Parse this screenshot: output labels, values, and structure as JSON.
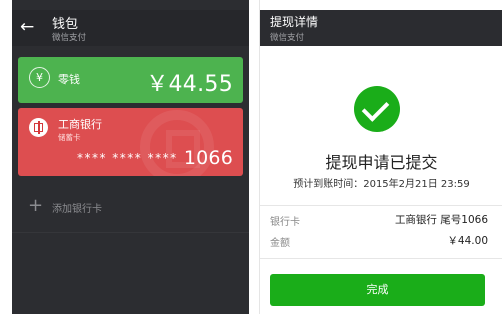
{
  "wallet": {
    "title": "钱包",
    "subtitle": "微信支付",
    "change": {
      "icon": "yen-circle-icon",
      "label": "零钱",
      "amount": "￥44.55"
    },
    "bank_card": {
      "icon": "icbc-logo-icon",
      "bank_name": "工商银行",
      "card_type": "储蓄卡",
      "masked": "**** **** ****",
      "last_digits": "1066"
    },
    "add_card_label": "添加银行卡"
  },
  "detail": {
    "title": "提现详情",
    "subtitle": "微信支付",
    "success": "提现申请已提交",
    "arrival": "预计到账时间：2015年2月21日 23:59",
    "rows": [
      {
        "label": "银行卡",
        "value": "工商银行 尾号1066"
      },
      {
        "label": "金额",
        "value": "￥44.00"
      }
    ],
    "done_label": "完成"
  },
  "colors": {
    "change_green": "#4db34f",
    "bank_red": "#dd4e50",
    "brand_green": "#1aad19",
    "dark_bg": "#2c2d31"
  }
}
